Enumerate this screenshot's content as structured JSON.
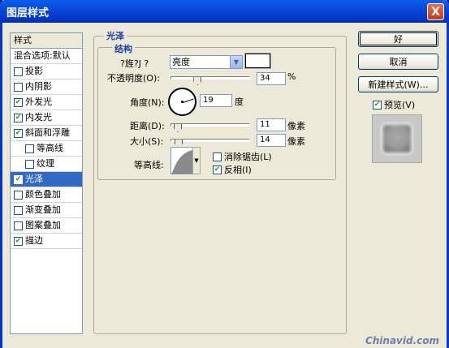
{
  "window": {
    "title": "图层样式",
    "close_glyph": "X"
  },
  "styles_panel": {
    "header": "样式",
    "blend_options": "混合选项:默认",
    "items": [
      {
        "label": "投影",
        "checked": false,
        "indent": false,
        "selected": false
      },
      {
        "label": "内阴影",
        "checked": false,
        "indent": false,
        "selected": false
      },
      {
        "label": "外发光",
        "checked": true,
        "indent": false,
        "selected": false
      },
      {
        "label": "内发光",
        "checked": true,
        "indent": false,
        "selected": false
      },
      {
        "label": "斜面和浮雕",
        "checked": true,
        "indent": false,
        "selected": false
      },
      {
        "label": "等高线",
        "checked": false,
        "indent": true,
        "selected": false
      },
      {
        "label": "纹理",
        "checked": false,
        "indent": true,
        "selected": false
      },
      {
        "label": "光泽",
        "checked": true,
        "indent": false,
        "selected": true
      },
      {
        "label": "颜色叠加",
        "checked": false,
        "indent": false,
        "selected": false
      },
      {
        "label": "渐变叠加",
        "checked": false,
        "indent": false,
        "selected": false
      },
      {
        "label": "图案叠加",
        "checked": false,
        "indent": false,
        "selected": false
      },
      {
        "label": "描边",
        "checked": true,
        "indent": false,
        "selected": false
      }
    ]
  },
  "satin": {
    "group_title": "光泽",
    "structure_title": "结构",
    "blend_mode_label": "?旌?J ?",
    "blend_mode_value": "亮度",
    "opacity_label": "不透明度(O):",
    "opacity_value": "34",
    "opacity_unit": "%",
    "opacity_fraction": 0.34,
    "angle_label": "角度(N):",
    "angle_value": "19",
    "angle_unit": "度",
    "distance_label": "距离(D):",
    "distance_value": "11",
    "distance_unit": "像素",
    "size_label": "大小(S):",
    "size_value": "14",
    "size_unit": "像素",
    "contour_label": "等高线:",
    "anti_alias_label": "消除锯齿(L)",
    "anti_alias_checked": false,
    "invert_label": "反相(I)",
    "invert_checked": true,
    "color": "#ffffff"
  },
  "buttons": {
    "ok": "好",
    "cancel": "取消",
    "new_style": "新建样式(W)...",
    "preview_label": "预览(V)",
    "preview_checked": true
  },
  "watermark": "Chinavid.com",
  "colors": {
    "title_bar": "#0848d8",
    "selection": "#316ac5",
    "group_title": "#1c3fa7",
    "check": "#21a121"
  }
}
